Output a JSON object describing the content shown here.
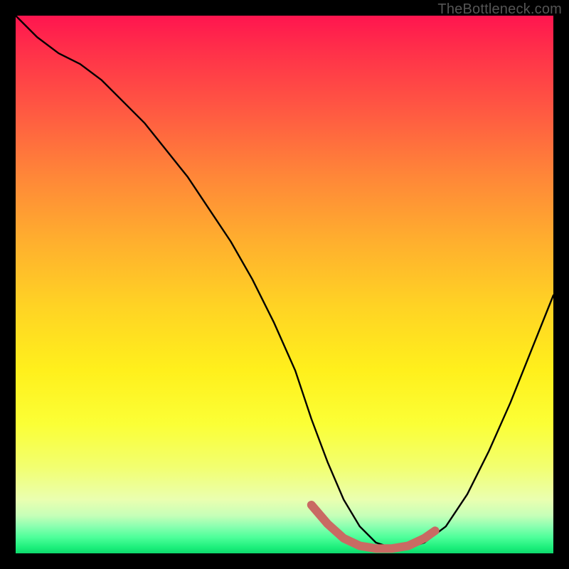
{
  "attribution": "TheBottleneck.com",
  "chart_data": {
    "type": "line",
    "title": "",
    "xlabel": "",
    "ylabel": "",
    "xlim": [
      0,
      100
    ],
    "ylim": [
      0,
      100
    ],
    "series": [
      {
        "name": "curve",
        "x": [
          0,
          4,
          8,
          12,
          16,
          20,
          24,
          28,
          32,
          36,
          40,
          44,
          48,
          52,
          55,
          58,
          61,
          64,
          67,
          70,
          73,
          76,
          80,
          84,
          88,
          92,
          96,
          100
        ],
        "y": [
          100,
          96,
          93,
          91,
          88,
          84,
          80,
          75,
          70,
          64,
          58,
          51,
          43,
          34,
          25,
          17,
          10,
          5,
          2,
          1,
          1,
          2,
          5,
          11,
          19,
          28,
          38,
          48
        ],
        "color": "#000000",
        "width": 2.4
      },
      {
        "name": "highlight",
        "x": [
          55,
          58,
          61,
          64,
          67,
          70,
          73,
          76,
          78
        ],
        "y": [
          9,
          5.5,
          2.8,
          1.4,
          0.9,
          0.9,
          1.4,
          2.8,
          4.2
        ],
        "color": "#c96a63",
        "width": 12,
        "cap": "round"
      }
    ],
    "gradient_stops": [
      {
        "pos": 0,
        "color": "#ff154f"
      },
      {
        "pos": 50,
        "color": "#ffbf28"
      },
      {
        "pos": 80,
        "color": "#f6ff50"
      },
      {
        "pos": 100,
        "color": "#0fd96d"
      }
    ]
  }
}
